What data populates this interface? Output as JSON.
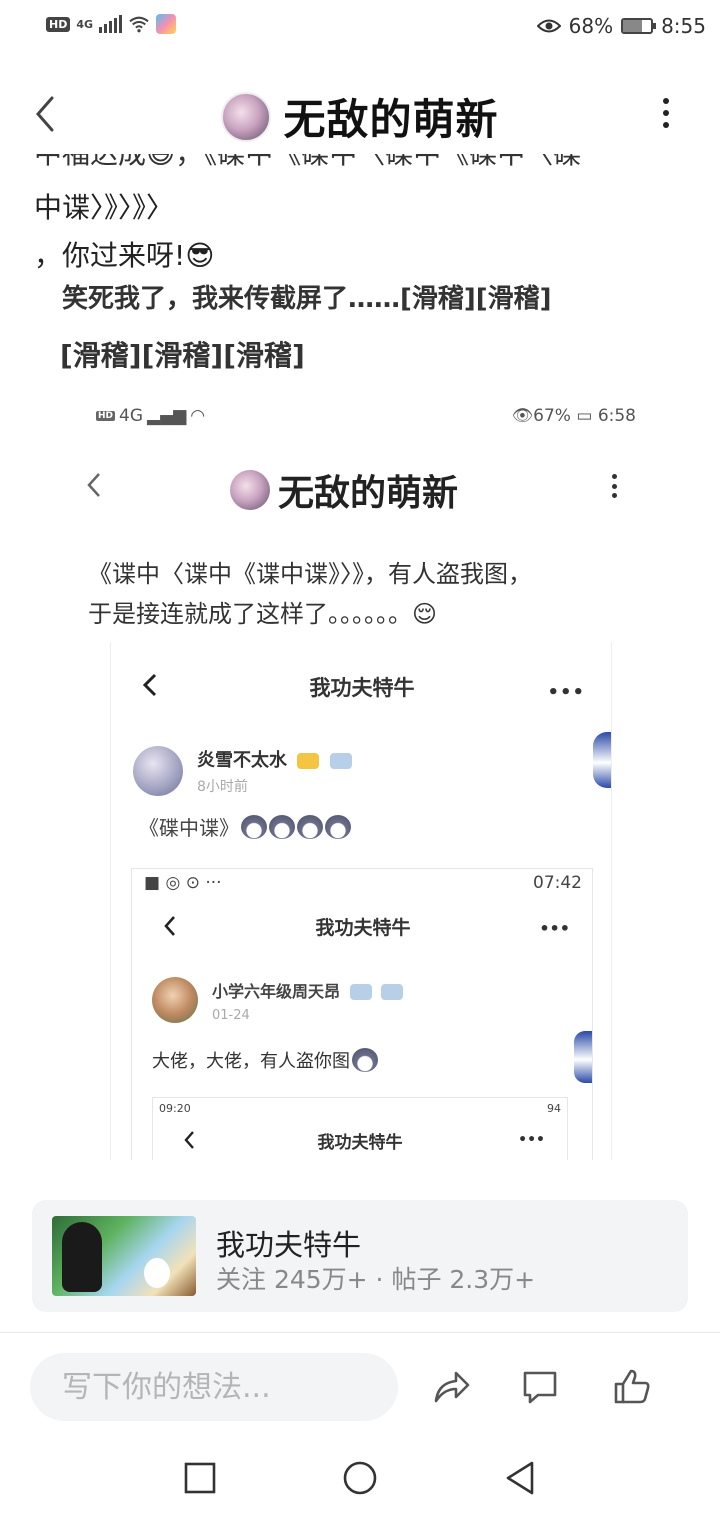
{
  "status_bar": {
    "left_badge": "HD",
    "network": "4G",
    "eye_percent": "68%",
    "time": "8:55",
    "battery_level": 0.68
  },
  "header": {
    "title": "无敌的萌新"
  },
  "post": {
    "line_cut": "中福达成😄，《碟中《碟中〈碟中《碟中〈碟",
    "line1": "中谍〉》〉》〉",
    "line2": "，你过来呀!😎",
    "line3": "笑死我了，我来传截屏了……[滑稽][滑稽]",
    "line4": "[滑稽][滑稽][滑稽]"
  },
  "screenshot1": {
    "status_left_badge": "HD",
    "network": "4G",
    "status_right": "👁67%",
    "time": "6:58",
    "title": "无敌的萌新",
    "text_line1": "《谍中〈谍中《谍中谍》〉》，有人盗我图，",
    "text_line2": "于是接连就成了这样了。。。。。。😌"
  },
  "screenshot2": {
    "header_title": "我功夫特牛",
    "more": "•••",
    "username": "炎雪不太水",
    "time_ago": "8小时前",
    "text": "《碟中谍》"
  },
  "screenshot3": {
    "status_left": "■ ◎ ⊙ ···",
    "status_right": "07:42",
    "header_title": "我功夫特牛",
    "more": "•••",
    "username": "小学六年级周天昂",
    "date": "01-24",
    "text": "大佬，大佬，有人盗你图"
  },
  "screenshot4": {
    "status_left": "09:20",
    "status_right": "94",
    "header_title": "我功夫特牛",
    "more": "•••"
  },
  "forum_card": {
    "name": "我功夫特牛",
    "stats": "关注 245万+ · 帖子 2.3万+"
  },
  "comment_bar": {
    "placeholder": "写下你的想法..."
  }
}
